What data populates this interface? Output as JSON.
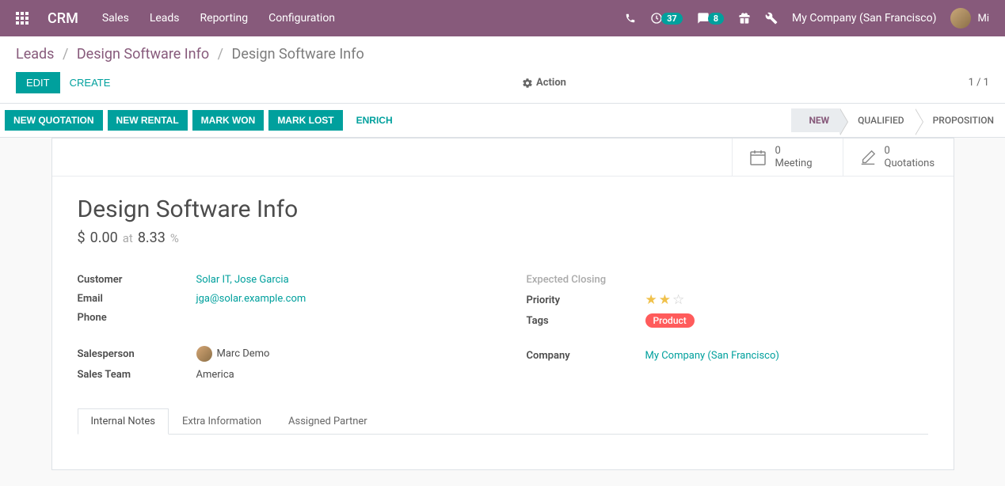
{
  "navbar": {
    "brand": "CRM",
    "menu": [
      "Sales",
      "Leads",
      "Reporting",
      "Configuration"
    ],
    "activity_count": "37",
    "discuss_count": "8",
    "company": "My Company (San Francisco)",
    "username": "Mi"
  },
  "breadcrumb": {
    "root": "Leads",
    "parent": "Design Software Info",
    "current": "Design Software Info"
  },
  "controls": {
    "edit": "Edit",
    "create": "Create",
    "action": "Action",
    "pager": "1 / 1"
  },
  "statusbar": {
    "buttons": [
      "NEW QUOTATION",
      "NEW RENTAL",
      "MARK WON",
      "MARK LOST"
    ],
    "secondary": "ENRICH",
    "stages": [
      "NEW",
      "QUALIFIED",
      "PROPOSITION"
    ],
    "active_stage": 0
  },
  "stat_buttons": {
    "meeting_count": "0",
    "meeting_label": "Meeting",
    "quotation_count": "0",
    "quotation_label": "Quotations"
  },
  "record": {
    "title": "Design Software Info",
    "amount_symbol": "$",
    "amount": "0.00",
    "at_label": "at",
    "probability": "8.33",
    "probability_unit": "%"
  },
  "fields": {
    "left": {
      "customer_label": "Customer",
      "customer_value": "Solar IT, Jose Garcia",
      "email_label": "Email",
      "email_value": "jga@solar.example.com",
      "phone_label": "Phone",
      "phone_value": "",
      "salesperson_label": "Salesperson",
      "salesperson_value": "Marc Demo",
      "team_label": "Sales Team",
      "team_value": "America"
    },
    "right": {
      "closing_label": "Expected Closing",
      "closing_value": "",
      "priority_label": "Priority",
      "priority_stars": 2,
      "tags_label": "Tags",
      "tag_value": "Product",
      "company_label": "Company",
      "company_value": "My Company (San Francisco)"
    }
  },
  "tabs": [
    "Internal Notes",
    "Extra Information",
    "Assigned Partner"
  ]
}
